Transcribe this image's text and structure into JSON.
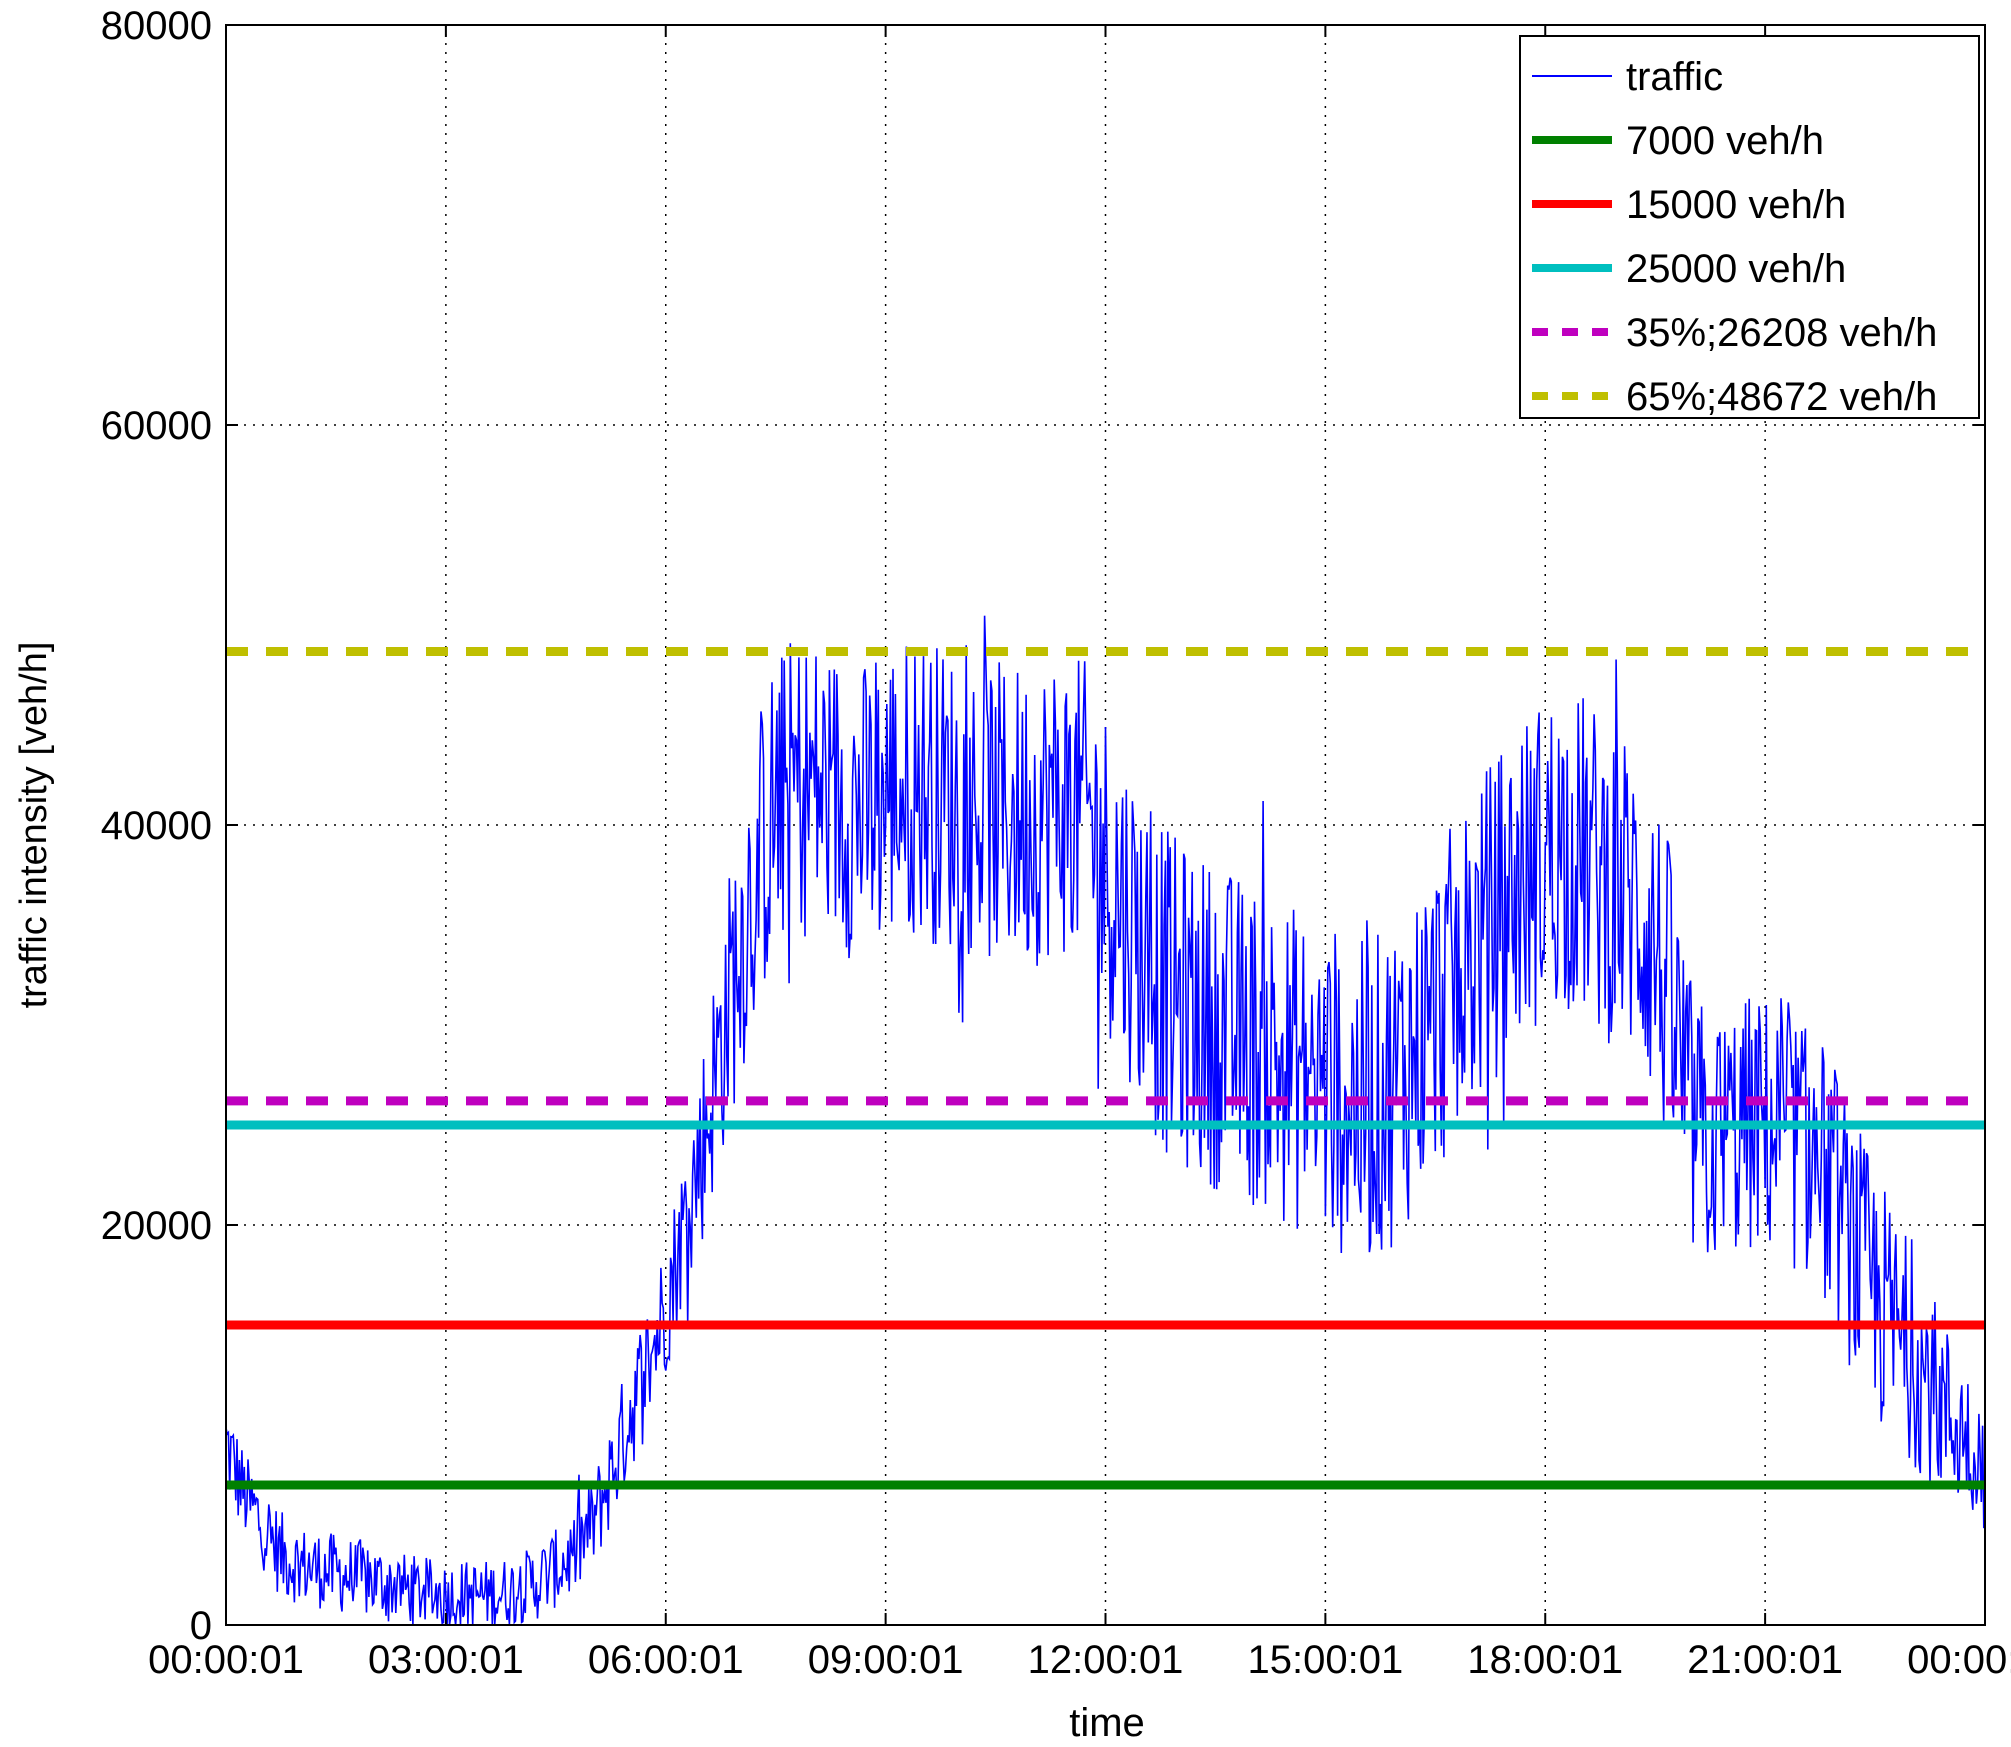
{
  "chart_data": {
    "type": "line",
    "title": "",
    "xlabel": "time",
    "ylabel": "traffic intensity [veh/h]",
    "x_ticks": [
      "00:00:01",
      "03:00:01",
      "06:00:01",
      "09:00:01",
      "12:00:01",
      "15:00:01",
      "18:00:01",
      "21:00:01",
      "00:00:01"
    ],
    "x_range_hours": [
      0,
      24
    ],
    "ylim": [
      0,
      80000
    ],
    "y_ticks": [
      "0",
      "20000",
      "40000",
      "60000",
      "80000"
    ],
    "grid": true,
    "legend_position": "top-right",
    "colors": {
      "traffic": "#0000ff",
      "t7000": "#008000",
      "t15000": "#ff0000",
      "t25000": "#00bfbf",
      "p35": "#bf00bf",
      "p65": "#bfbf00",
      "grid": "#000000"
    },
    "series": [
      {
        "name": "traffic",
        "style": "thin-line",
        "x_hours": [
          0,
          0.25,
          0.5,
          0.75,
          1,
          1.25,
          1.5,
          1.75,
          2,
          2.25,
          2.5,
          2.75,
          3,
          3.25,
          3.5,
          3.75,
          4,
          4.25,
          4.5,
          4.75,
          5,
          5.25,
          5.5,
          5.75,
          6,
          6.25,
          6.5,
          6.75,
          7,
          7.25,
          7.5,
          7.75,
          8,
          8.25,
          8.5,
          8.75,
          9,
          9.25,
          9.5,
          9.75,
          10,
          10.25,
          10.5,
          10.75,
          11,
          11.25,
          11.5,
          11.75,
          12,
          12.25,
          12.5,
          12.75,
          13,
          13.25,
          13.5,
          13.75,
          14,
          14.25,
          14.5,
          14.75,
          15,
          15.25,
          15.5,
          15.75,
          16,
          16.25,
          16.5,
          16.75,
          17,
          17.25,
          17.5,
          17.75,
          18,
          18.25,
          18.5,
          18.75,
          19,
          19.25,
          19.5,
          19.75,
          20,
          20.25,
          20.5,
          20.75,
          21,
          21.25,
          21.5,
          21.75,
          22,
          22.25,
          22.5,
          22.75,
          23,
          23.25,
          23.5,
          23.75,
          24
        ],
        "y_mean": [
          9000,
          6500,
          5000,
          3500,
          3000,
          2800,
          2600,
          2400,
          2200,
          2000,
          1800,
          1600,
          1500,
          1500,
          1500,
          1600,
          1800,
          2200,
          2800,
          3500,
          5000,
          7500,
          10500,
          13000,
          16000,
          20000,
          24000,
          29000,
          34000,
          38000,
          41000,
          42000,
          42000,
          41500,
          41000,
          40500,
          41500,
          42000,
          42000,
          41500,
          41000,
          41000,
          40500,
          40500,
          40500,
          41000,
          41000,
          40500,
          38000,
          36000,
          34000,
          32000,
          31000,
          30500,
          30000,
          29500,
          29000,
          28500,
          28000,
          27500,
          27000,
          26500,
          26000,
          26500,
          27500,
          29000,
          30500,
          32000,
          33500,
          35000,
          36500,
          37500,
          38500,
          39000,
          38500,
          37500,
          37000,
          36000,
          34000,
          30000,
          25000,
          24000,
          24500,
          25000,
          25000,
          24500,
          24000,
          23000,
          21000,
          18500,
          16500,
          15000,
          13500,
          12000,
          10500,
          9500,
          8000
        ],
        "y_amp": [
          2500,
          2000,
          2000,
          2000,
          1800,
          1800,
          1800,
          1800,
          1800,
          1600,
          1600,
          1600,
          1600,
          1600,
          1600,
          1600,
          1600,
          1800,
          1800,
          2000,
          2200,
          2500,
          2800,
          3000,
          3200,
          3500,
          4500,
          5500,
          6500,
          7000,
          7000,
          7000,
          7000,
          7000,
          7000,
          7000,
          7000,
          7000,
          7000,
          7000,
          7000,
          7000,
          7000,
          7000,
          7000,
          7000,
          7000,
          7000,
          7500,
          7500,
          7500,
          7500,
          7500,
          7500,
          7500,
          7500,
          7500,
          7500,
          7500,
          7500,
          7500,
          7500,
          7500,
          7500,
          7500,
          7500,
          7500,
          7500,
          7500,
          7500,
          7500,
          7500,
          7500,
          7500,
          7500,
          7500,
          7500,
          7500,
          7500,
          7500,
          6500,
          6000,
          6000,
          6000,
          6000,
          6000,
          6000,
          6000,
          6000,
          6000,
          6000,
          5500,
          5000,
          4500,
          4000,
          3500,
          3000
        ]
      },
      {
        "name": "7000 veh/h",
        "style": "solid-thick",
        "value": 7000
      },
      {
        "name": "15000 veh/h",
        "style": "solid-thick",
        "value": 15000
      },
      {
        "name": "25000 veh/h",
        "style": "solid-thick",
        "value": 25000
      },
      {
        "name": "35%;26208 veh/h",
        "style": "dashed-thick",
        "value": 26208
      },
      {
        "name": "65%;48672 veh/h",
        "style": "dashed-thick",
        "value": 48672
      }
    ]
  }
}
